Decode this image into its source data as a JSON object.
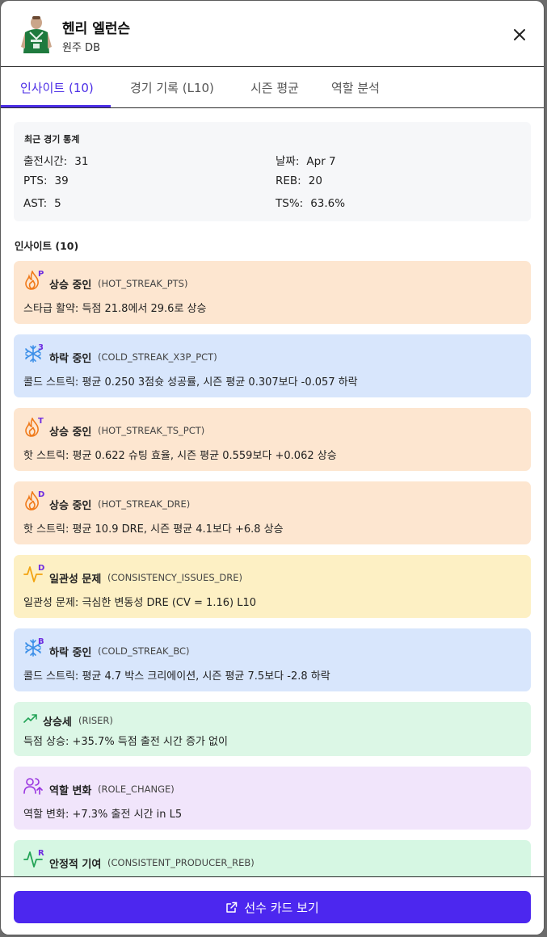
{
  "player": {
    "name": "헨리 엘런슨",
    "team": "원주 DB"
  },
  "tabs": [
    {
      "label": "인사이트 (10)"
    },
    {
      "label": "경기 기록 (L10)"
    },
    {
      "label": "시즌 평균"
    },
    {
      "label": "역할 분석"
    }
  ],
  "active_tab": 0,
  "recent_stats": {
    "title": "최근 경기 통계",
    "items": [
      {
        "label": "출전시간:",
        "value": "31"
      },
      {
        "label": "날짜:",
        "value": "Apr 7"
      },
      {
        "label": "PTS:",
        "value": "39"
      },
      {
        "label": "REB:",
        "value": "20"
      },
      {
        "label": "AST:",
        "value": "5"
      },
      {
        "label": "TS%:",
        "value": "63.6%"
      }
    ]
  },
  "insights_title": "인사이트 (10)",
  "insights": [
    {
      "icon": "flame-icon",
      "badge": "P",
      "label": "상승 중인",
      "code": "(HOT_STREAK_PTS)",
      "desc": "스타급 활약: 득점 21.8에서 29.6로 상승",
      "bg": "#fde6d0"
    },
    {
      "icon": "snowflake-icon",
      "badge": "3",
      "label": "하락 중인",
      "code": "(COLD_STREAK_X3P_PCT)",
      "desc": "콜드 스트릭: 평균 0.250 3점슛 성공률, 시즌 평균 0.307보다 -0.057 하락",
      "bg": "#d8e6fc"
    },
    {
      "icon": "flame-icon",
      "badge": "T",
      "label": "상승 중인",
      "code": "(HOT_STREAK_TS_PCT)",
      "desc": "핫 스트릭: 평균 0.622 슈팅 효율, 시즌 평균 0.559보다 +0.062 상승",
      "bg": "#fde6d0"
    },
    {
      "icon": "flame-icon",
      "badge": "D",
      "label": "상승 중인",
      "code": "(HOT_STREAK_DRE)",
      "desc": "핫 스트릭: 평균 10.9 DRE, 시즌 평균 4.1보다 +6.8 상승",
      "bg": "#fde6d0"
    },
    {
      "icon": "pulse-icon",
      "badge": "D",
      "label": "일관성 문제",
      "code": "(CONSISTENCY_ISSUES_DRE)",
      "desc": "일관성 문제: 극심한 변동성 DRE (CV = 1.16) L10",
      "bg": "#fdf0c4"
    },
    {
      "icon": "snowflake-icon",
      "badge": "B",
      "label": "하락 중인",
      "code": "(COLD_STREAK_BC)",
      "desc": "콜드 스트릭: 평균 4.7 박스 크리에이션, 시즌 평균 7.5보다 -2.8 하락",
      "bg": "#d8e6fc"
    },
    {
      "icon": "trending-up-icon",
      "badge": "",
      "label": "상승세",
      "code": "(RISER)",
      "desc": "득점 상승: +35.7% 득점 출전 시간 증가 없이",
      "bg": "#dcf7e6"
    },
    {
      "icon": "users-icon",
      "badge": "",
      "label": "역할 변화",
      "code": "(ROLE_CHANGE)",
      "desc": "역할 변화: +7.3% 출전 시간 in L5",
      "bg": "#f1e5fb"
    },
    {
      "icon": "pulse-icon",
      "badge": "R",
      "label": "안정적 기여",
      "code": "(CONSISTENT_PRODUCER_REB)",
      "desc": "",
      "bg": "#d6f7e3"
    }
  ],
  "cta": {
    "label": "선수 카드 보기"
  },
  "colors": {
    "accent": "#4c2ee6",
    "flame": "#f07a1a",
    "snow": "#3b8fe8",
    "trend": "#22a356",
    "badge": "#6f2de0"
  }
}
